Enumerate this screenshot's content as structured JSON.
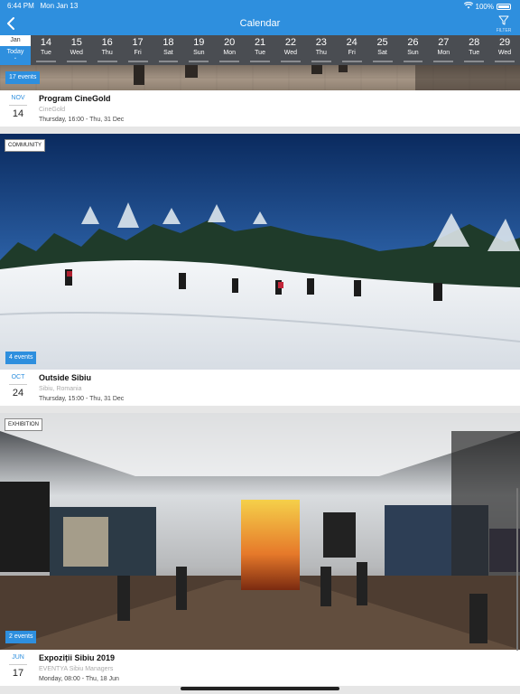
{
  "status_bar": {
    "time": "6:44 PM",
    "date": "Mon Jan 13",
    "battery": "100%"
  },
  "navbar": {
    "title": "Calendar",
    "filter_label": "FILTER"
  },
  "datebar": {
    "month": "Jan",
    "today_label": "Today",
    "days": [
      {
        "num": "14",
        "wd": "Tue"
      },
      {
        "num": "15",
        "wd": "Wed"
      },
      {
        "num": "16",
        "wd": "Thu"
      },
      {
        "num": "17",
        "wd": "Fri"
      },
      {
        "num": "18",
        "wd": "Sat"
      },
      {
        "num": "19",
        "wd": "Sun"
      },
      {
        "num": "20",
        "wd": "Mon"
      },
      {
        "num": "21",
        "wd": "Tue"
      },
      {
        "num": "22",
        "wd": "Wed"
      },
      {
        "num": "23",
        "wd": "Thu"
      },
      {
        "num": "24",
        "wd": "Fri"
      },
      {
        "num": "25",
        "wd": "Sat"
      },
      {
        "num": "26",
        "wd": "Sun"
      },
      {
        "num": "27",
        "wd": "Mon"
      },
      {
        "num": "28",
        "wd": "Tue"
      },
      {
        "num": "29",
        "wd": "Wed"
      }
    ]
  },
  "events": [
    {
      "count": "17 events",
      "month": "NOV",
      "day": "14",
      "title": "Program CineGold",
      "location": "CineGold",
      "time": "Thursday, 16:00 - Thu, 31 Dec"
    },
    {
      "category": "COMMUNITY",
      "count": "4 events",
      "month": "OCT",
      "day": "24",
      "title": "Outside Sibiu",
      "location": "Sibiu, Romania",
      "time": "Thursday, 15:00 - Thu, 31 Dec"
    },
    {
      "category": "EXHIBITION",
      "count": "2 events",
      "month": "JUN",
      "day": "17",
      "title": "Expoziții Sibiu 2019",
      "location": "EVENTYA Sibiu Managers",
      "time": "Monday, 08:00 - Thu, 18 Jun"
    }
  ]
}
